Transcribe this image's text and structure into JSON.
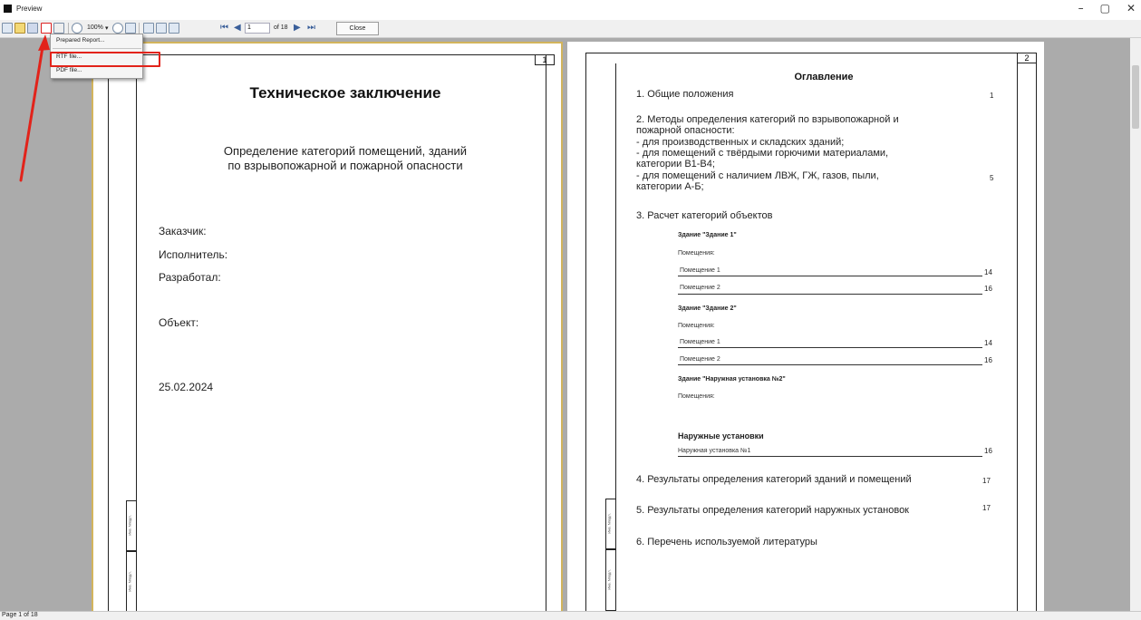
{
  "window": {
    "title": "Preview",
    "minimize": "–",
    "maximize": "▢",
    "close": "✕"
  },
  "toolbar": {
    "zoom": "100%",
    "page_current": "1",
    "page_total": "of 18",
    "close_label": "Close"
  },
  "dropdown": {
    "items": [
      "Prepared Report...",
      "RTF file...",
      "PDF file..."
    ]
  },
  "statusbar": {
    "text": "Page 1 of 18"
  },
  "page1": {
    "number": "1",
    "title": "Техническое заключение",
    "subtitle_line1": "Определение категорий помещений, зданий",
    "subtitle_line2": "по взрывопожарной и пожарной опасности",
    "customer": "Заказчик:",
    "executor": "Исполнитель:",
    "developer": "Разработал:",
    "object": "Объект:",
    "date": "25.02.2024",
    "stamp1": "Инв. Nподл.",
    "stamp2": "Инв. Nподл."
  },
  "page2": {
    "number": "2",
    "toc_title": "Оглавление",
    "s1": "1. Общие положения",
    "s1_page": "1",
    "s2_l1": "2. Методы определения категорий по взрывопожарной и",
    "s2_l2": "пожарной опасности:",
    "s2_l3": "- для производственных и складских зданий;",
    "s2_l4": "- для помещений с твёрдыми горючими материалами,",
    "s2_l5": "категории  В1-В4;",
    "s2_l6": "- для помещений с наличием ЛВЖ, ГЖ, газов, пыли,",
    "s2_l7": "категории А-Б;",
    "s2_page": "5",
    "s3": "3. Расчет категорий объектов",
    "b1_title": "Здание \"Здание 1\"",
    "b1_rooms": "Помещения:",
    "b1_r1": "Помещение 1",
    "b1_r1_page": "14",
    "b1_r2": "Помещение 2",
    "b1_r2_page": "16",
    "b2_title": "Здание \"Здание 2\"",
    "b2_rooms": "Помещения:",
    "b2_r1": "Помещение 1",
    "b2_r1_page": "14",
    "b2_r2": "Помещение 2",
    "b2_r2_page": "16",
    "b3_title": "Здание \"Наружная установка №2\"",
    "b3_rooms": "Помещения:",
    "ext_title": "Наружные установки",
    "ext_item": "Наружная установка №1",
    "ext_item_page": "16",
    "s4": "4. Результаты определения категорий зданий и помещений",
    "s4_page": "17",
    "s5": "5. Результаты определения категорий наружных установок",
    "s5_page": "17",
    "s6": "6. Перечень используемой литературы",
    "stamp1": "Инв. Nподл.",
    "stamp2": "Инв. Nподл."
  }
}
